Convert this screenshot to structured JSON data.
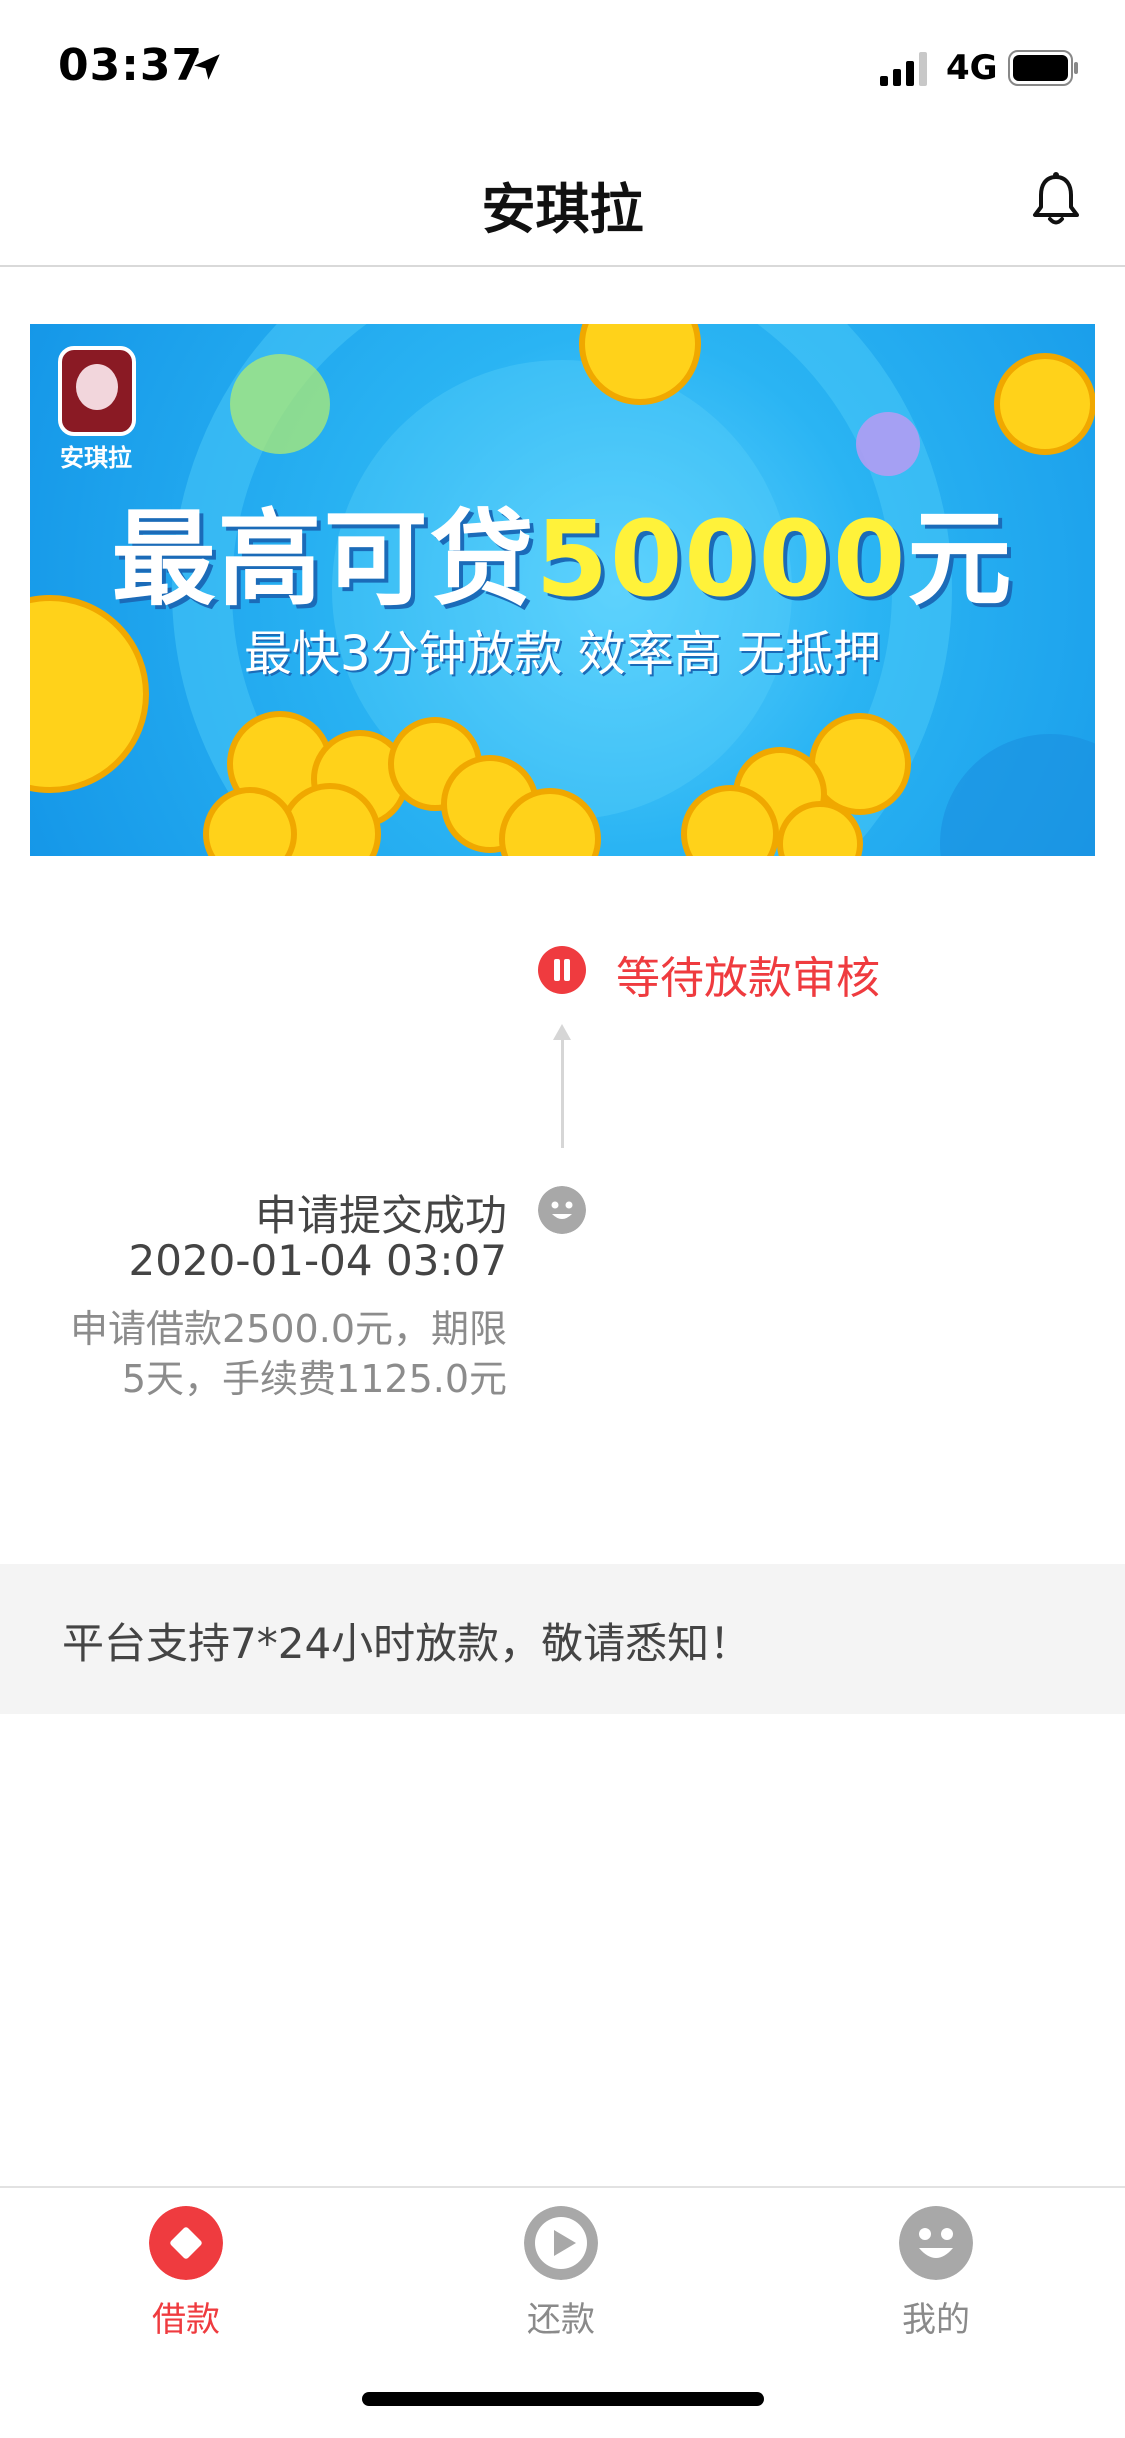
{
  "status_bar": {
    "time": "03:37",
    "network": "4G",
    "icons": [
      "location-arrow-icon",
      "cellular-signal-icon",
      "battery-icon"
    ]
  },
  "header": {
    "title": "安琪拉",
    "right_icon": "bell-icon"
  },
  "banner": {
    "logo_label": "安琪拉",
    "headline_prefix": "最高可贷",
    "headline_amount": "50000",
    "headline_suffix": "元",
    "subline": "最快3分钟放款 效率高 无抵押"
  },
  "timeline": {
    "current_step": {
      "label": "等待放款审核",
      "icon": "pause-icon",
      "color": "#ef3b3f"
    },
    "completed_step": {
      "title": "申请提交成功",
      "time": "2020-01-04 03:07",
      "description": "申请借款2500.0元，期限5天，手续费1125.0元",
      "icon": "smiley-icon"
    }
  },
  "notice": {
    "text": "平台支持7*24小时放款，敬请悉知！"
  },
  "tabbar": {
    "tabs": [
      {
        "label": "借款",
        "icon": "diamond-icon",
        "active": true
      },
      {
        "label": "还款",
        "icon": "play-icon",
        "active": false
      },
      {
        "label": "我的",
        "icon": "smiley-icon",
        "active": false
      }
    ],
    "active_color": "#ef3b3f",
    "inactive_color": "#a8a8a8"
  }
}
